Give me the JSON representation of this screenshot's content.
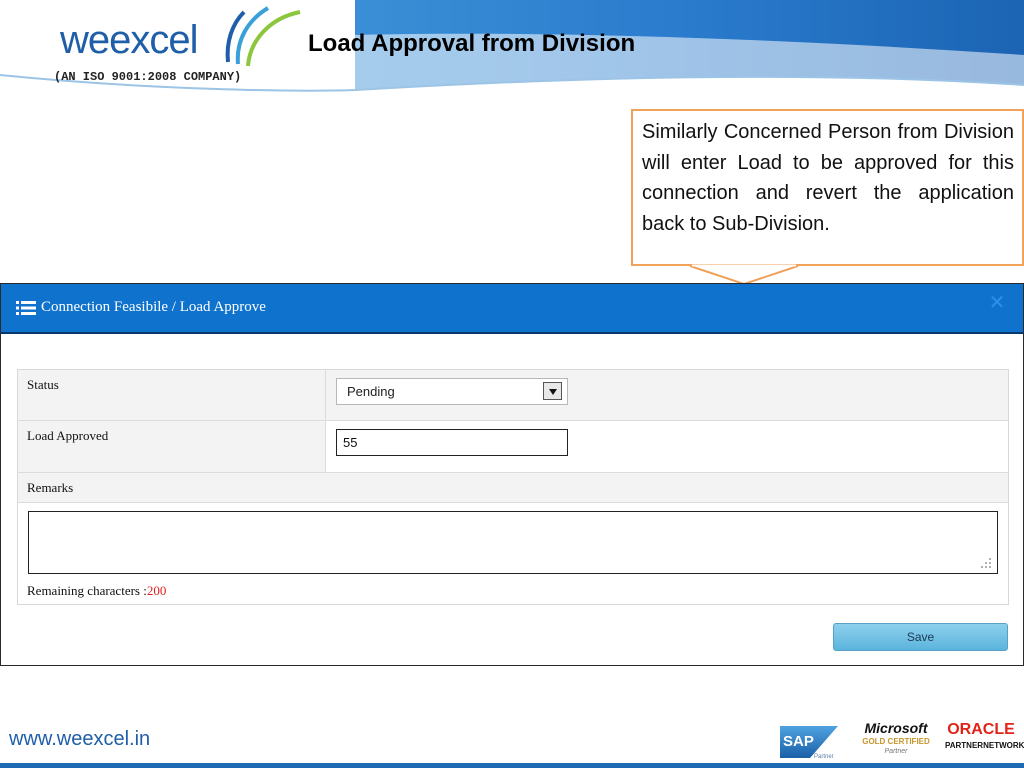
{
  "header": {
    "logo_text": "weexcel",
    "logo_subtitle": "(AN ISO 9001:2008 COMPANY)",
    "slide_title": "Load Approval from Division"
  },
  "callout": {
    "text": "Similarly Concerned Person from Division will enter Load to be approved for this  connection and revert the application back to Sub-Division."
  },
  "dialog": {
    "title_icon": "list-icon",
    "title": "Connection Feasibile / Load Approve",
    "close_icon": "close-icon",
    "status": {
      "label": "Status",
      "selected": "Pending"
    },
    "load_approved": {
      "label": "Load Approved",
      "value": "55"
    },
    "remarks": {
      "label": "Remarks",
      "value": "",
      "remaining_label": "Remaining characters :",
      "remaining_count": "200"
    },
    "save_label": "Save"
  },
  "footer": {
    "url": "www.weexcel.in",
    "partners": {
      "sap": {
        "name": "SAP",
        "tag": "Partner"
      },
      "microsoft": {
        "name": "Microsoft",
        "cert": "GOLD CERTIFIED",
        "tag": "Partner"
      },
      "oracle": {
        "name": "ORACLE",
        "tag": "PARTNERNETWORK"
      }
    }
  },
  "colors": {
    "brand_blue": "#1f5ea8",
    "dialog_header": "#0f73ce",
    "callout_border": "#f0a15a",
    "remaining_count": "#e02020",
    "save_button": "#5bb4dd"
  }
}
